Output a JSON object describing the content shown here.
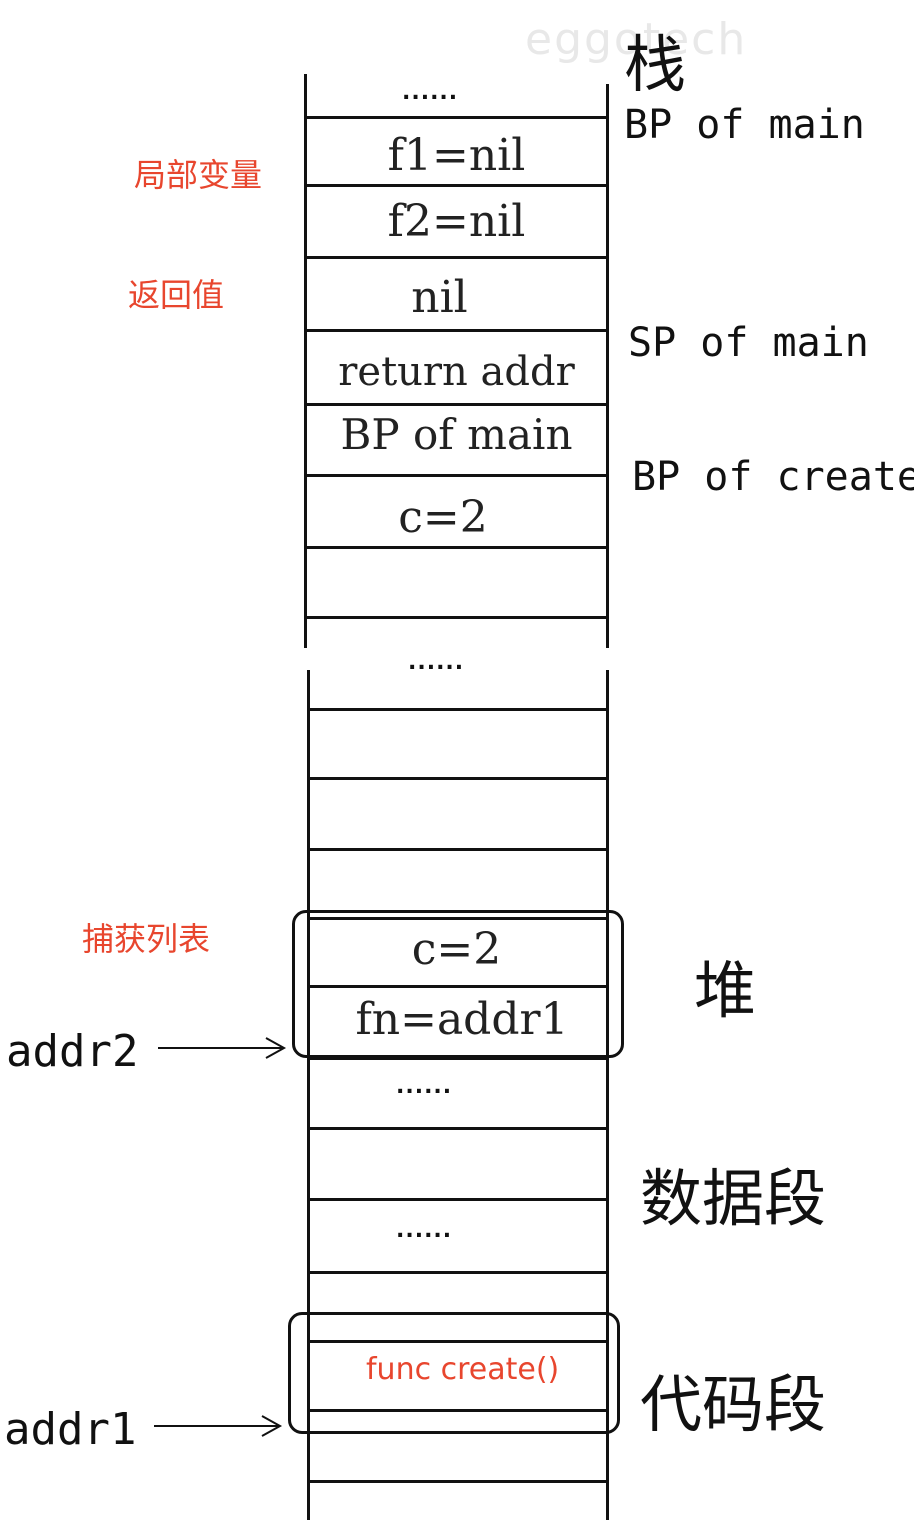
{
  "watermark": "eggotech",
  "stack": {
    "heading": "栈",
    "top_dots": "......",
    "cells": [
      "f1=nil",
      "f2=nil",
      "nil",
      "return addr",
      "BP of main",
      "c=2"
    ],
    "mid_dots": "......",
    "right_labels": {
      "bp_main": "BP of main",
      "sp_main": "SP of main",
      "bp_create": "BP of create"
    }
  },
  "annotations": {
    "local_vars": "局部变量",
    "return_value": "返回值",
    "capture_list": "捕获列表",
    "func_create": "func create()"
  },
  "heap": {
    "label": "堆",
    "cells": [
      "c=2",
      "fn=addr1"
    ],
    "dots": "......",
    "pointer": "addr2"
  },
  "data_segment": {
    "label": "数据段",
    "dots": "......"
  },
  "code_segment": {
    "label": "代码段",
    "pointer": "addr1"
  },
  "colors": {
    "annotation": "#e8462e",
    "ink": "#111111"
  }
}
